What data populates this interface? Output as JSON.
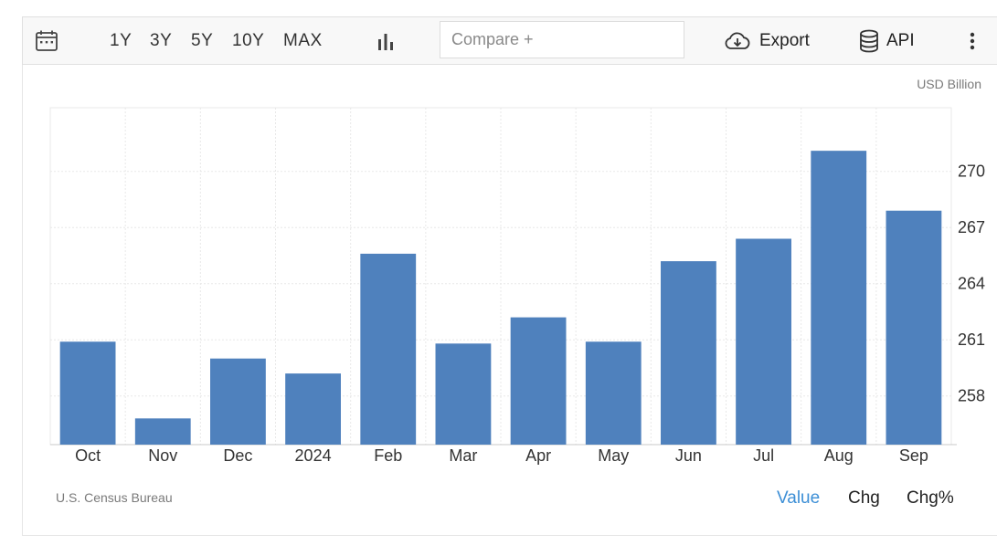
{
  "toolbar": {
    "ranges": [
      "1Y",
      "3Y",
      "5Y",
      "10Y",
      "MAX"
    ],
    "compare_placeholder": "Compare +",
    "export_label": "Export",
    "api_label": "API"
  },
  "unit_label": "USD Billion",
  "source_label": "U.S. Census Bureau",
  "modes": [
    "Value",
    "Chg",
    "Chg%"
  ],
  "active_mode": "Value",
  "colors": {
    "bar": "#4f81bd",
    "accent": "#3d8fd6",
    "grid": "#e8e8e8"
  },
  "chart_data": {
    "type": "bar",
    "categories": [
      "Oct",
      "Nov",
      "Dec",
      "2024",
      "Feb",
      "Mar",
      "Apr",
      "May",
      "Jun",
      "Jul",
      "Aug",
      "Sep"
    ],
    "values": [
      260.9,
      256.8,
      260.0,
      259.2,
      265.6,
      260.8,
      262.2,
      260.9,
      265.2,
      266.4,
      271.1,
      267.9
    ],
    "yticks": [
      258,
      261,
      264,
      267,
      270
    ],
    "ylim": [
      255.4,
      273.4
    ],
    "ylabel": "USD Billion",
    "xlabel": "",
    "grid": true,
    "y_axis_side": "right"
  }
}
